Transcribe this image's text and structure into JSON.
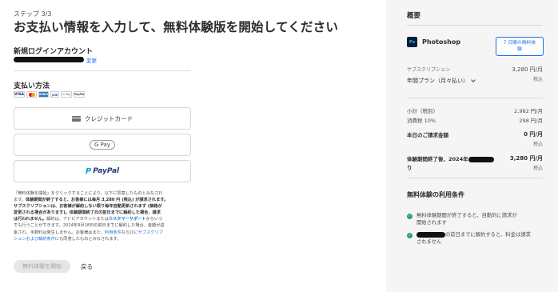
{
  "page": {
    "step": "ステップ 3/3",
    "title": "お支払い情報を入力して、無料体験版を開始してください"
  },
  "account": {
    "label": "新規ログインアカウント",
    "change_link": "変更"
  },
  "payment": {
    "label": "支払い方法",
    "card_brands": [
      "VISA",
      "MC",
      "AMEX",
      "JCB",
      "G Pay",
      "PayPal"
    ],
    "credit_card_label": "クレジットカード",
    "gpay_label": "G Pay",
    "paypal_label": "PayPal"
  },
  "legal": {
    "line1": "「無料体験を開始」をクリックすることにより、以下に同意したものとみなされ",
    "line2_pre": "ます。",
    "line2_bold": "体験期間が終了すると、お客様には毎月 3,280 円 (税込) が請求されます。",
    "line3_bold": "サブスクリプションは、お客様が解約しない限り毎年自動更新されます (価格が",
    "line4_bold": "変更される場合があります)。体験期間終了日の前日までに解約した場合、請求",
    "line5_bold": "は行われません。",
    "line5_rest": "解約は、アドビアカウントまたは",
    "line5_link": "カスタマーサポート",
    "line5_end": "からいつ",
    "line6": "でも行うことができます。2024年9月18日の前日までに解約した場合、金額が返",
    "line7_pre": "金され、手数料は発生しません。お客様はまた、",
    "line7_link": "利用条件",
    "line7_mid": "ならびに",
    "line7_link2": "サブスクリプ",
    "line8_link": "ションおよび解約条件",
    "line8_end": "にも同意したものとみなされます。"
  },
  "actions": {
    "start_label": "無料体験を開始",
    "back_label": "戻る"
  },
  "summary": {
    "title": "概要",
    "product_name": "Photoshop",
    "product_icon": "Ps",
    "trial_badge_line1": "7 日間の無料体",
    "trial_badge_line2": "験",
    "subscription_label": "サブスクリプション",
    "subscription_price": "3,280 円/月",
    "subscription_tax": "税込",
    "plan_label": "年間プラン（月々払い）",
    "subtotal_label": "小計（税別）",
    "subtotal_value": "2,982 円/月",
    "tax_label": "消費税 10%",
    "tax_value": "298 円/月",
    "today_label": "本日のご請求金額",
    "today_value": "0 円/月",
    "today_tax": "税込",
    "after_label_pre": "体験期間終了後、2024年",
    "after_label_post": "り",
    "after_value": "3,280 円/月",
    "after_tax": "税込"
  },
  "conditions": {
    "title": "無料体験の利用条件",
    "item1_line1": "無料体験期間が終了すると、自動的に請求が",
    "item1_line2": "開始されます",
    "item2_line1": "の前日までに解約すると、料金は請求",
    "item2_line2": "されません"
  }
}
